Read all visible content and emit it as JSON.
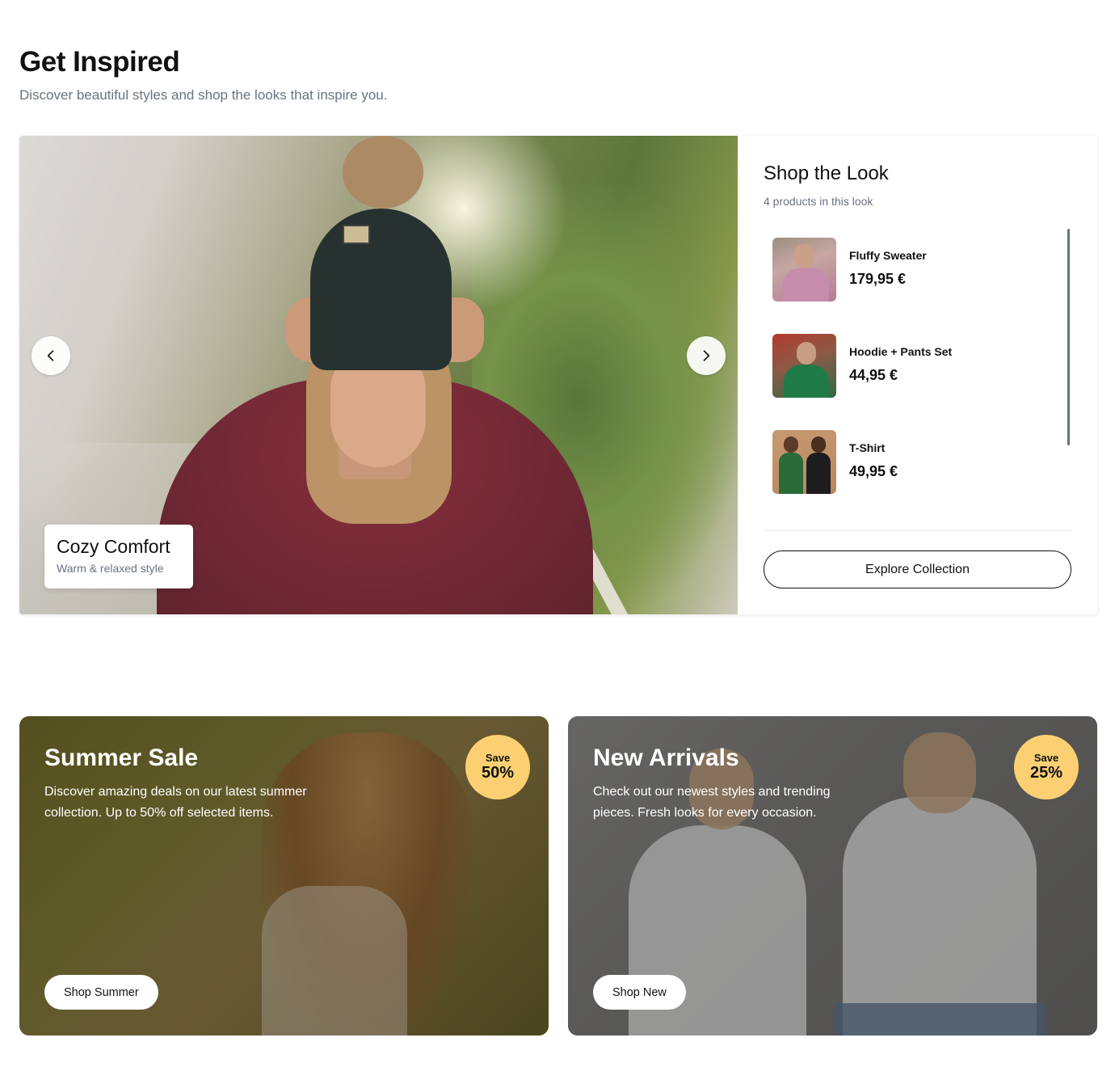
{
  "header": {
    "title": "Get Inspired",
    "subtitle": "Discover beautiful styles and shop the looks that inspire you."
  },
  "look": {
    "caption_title": "Cozy Comfort",
    "caption_subtitle": "Warm & relaxed style",
    "prev_icon": "chevron-left-icon",
    "next_icon": "chevron-right-icon"
  },
  "shop_panel": {
    "title": "Shop the Look",
    "subtitle": "4 products in this look",
    "products": [
      {
        "name": "Fluffy Sweater",
        "price": "179,95 €"
      },
      {
        "name": "Hoodie + Pants Set",
        "price": "44,95 €"
      },
      {
        "name": "T-Shirt",
        "price": "49,95 €"
      }
    ],
    "explore_label": "Explore Collection"
  },
  "promos": {
    "summer": {
      "title": "Summer Sale",
      "description": "Discover amazing deals on our latest summer collection. Up to 50% off selected items.",
      "badge_top": "Save",
      "badge_value": "50%",
      "button": "Shop Summer"
    },
    "new": {
      "title": "New Arrivals",
      "description": "Check out our newest styles and trending pieces. Fresh looks for every occasion.",
      "badge_top": "Save",
      "badge_value": "25%",
      "button": "Shop New"
    }
  },
  "colors": {
    "badge": "#fcd072",
    "text": "#111111",
    "muted": "#6b7280"
  }
}
